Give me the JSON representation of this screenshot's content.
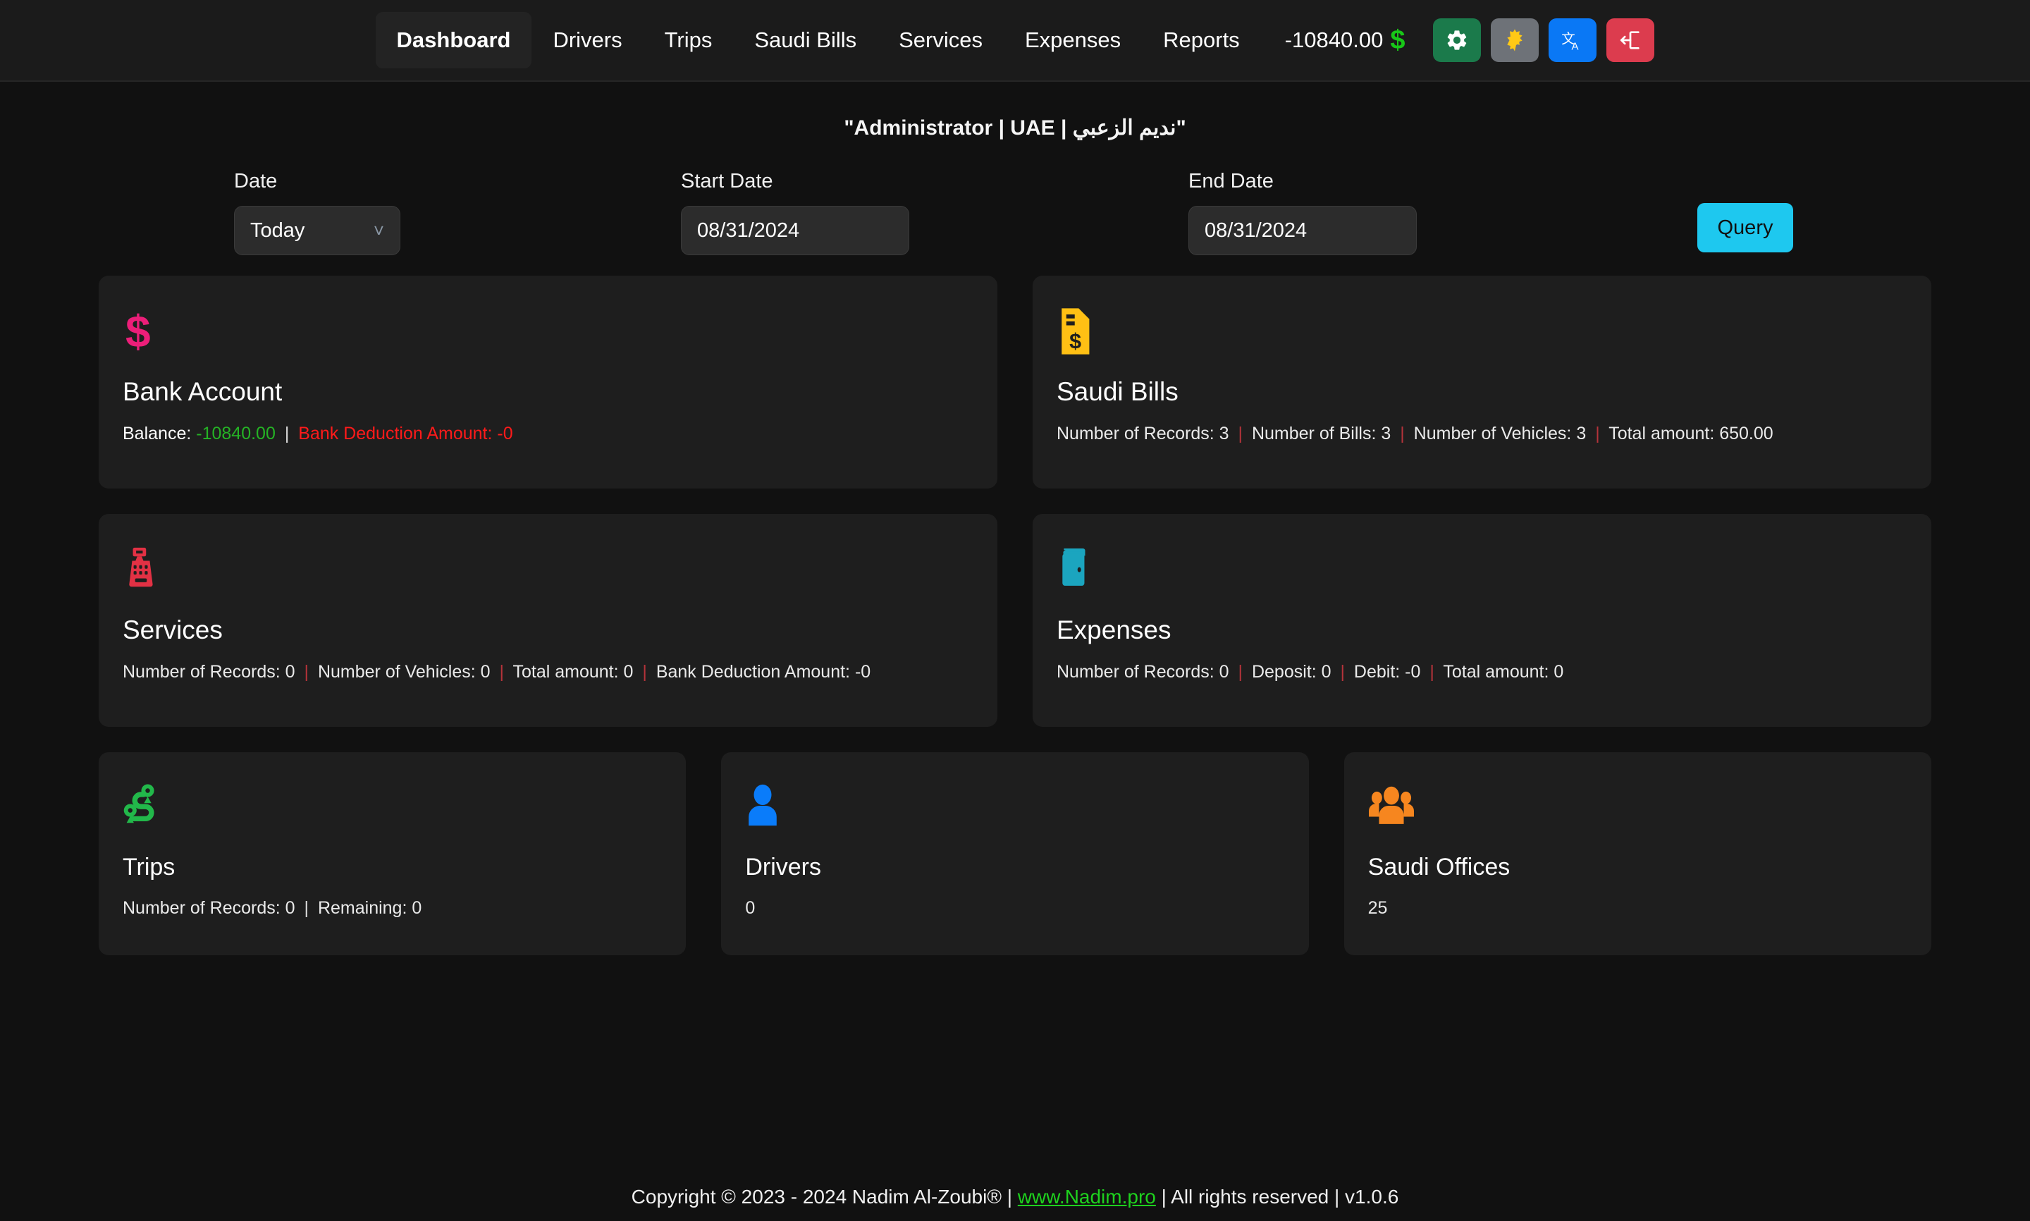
{
  "navbar": {
    "links": [
      {
        "label": "Dashboard",
        "active": true
      },
      {
        "label": "Drivers",
        "active": false
      },
      {
        "label": "Trips",
        "active": false
      },
      {
        "label": "Saudi Bills",
        "active": false
      },
      {
        "label": "Services",
        "active": false
      },
      {
        "label": "Expenses",
        "active": false
      },
      {
        "label": "Reports",
        "active": false
      }
    ],
    "balance": "-10840.00",
    "balance_symbol": "$",
    "balance_symbol_color": "#18c718",
    "buttons": [
      {
        "name": "settings-button",
        "icon": "gear-icon",
        "color": "#1b7a4b"
      },
      {
        "name": "theme-toggle-button",
        "icon": "sun-icon",
        "color": "#6e7278"
      },
      {
        "name": "language-button",
        "icon": "translate-icon",
        "color": "#0a78f5"
      },
      {
        "name": "logout-button",
        "icon": "logout-icon",
        "color": "#dc3c4e"
      }
    ]
  },
  "user_header": "\"نديم الزعبي | Administrator | UAE\"",
  "filters": {
    "date": {
      "label": "Date",
      "value": "Today",
      "options": [
        "Today"
      ]
    },
    "start_date": {
      "label": "Start Date",
      "value": "08/31/2024"
    },
    "end_date": {
      "label": "End Date",
      "value": "08/31/2024"
    },
    "query_button": "Query"
  },
  "cards": {
    "bank_account": {
      "title": "Bank Account",
      "icon": "dollar-sign-icon",
      "icon_color": "#ec1e79",
      "balance_label": "Balance:",
      "balance_value": "-10840.00",
      "deduction_text": "Bank Deduction Amount: -0"
    },
    "saudi_bills": {
      "title": "Saudi Bills",
      "icon": "invoice-icon",
      "icon_color": "#ffc014",
      "stat_records": "Number of Records: 3",
      "stat_bills": "Number of Bills: 3",
      "stat_vehicles": "Number of Vehicles: 3",
      "stat_total": "Total amount: 650.00"
    },
    "services": {
      "title": "Services",
      "icon": "cash-register-icon",
      "icon_color": "#e23144",
      "stat_records": "Number of Records: 0",
      "stat_vehicles": "Number of Vehicles: 0",
      "stat_total": "Total amount: 0",
      "stat_deduction": "Bank Deduction Amount: -0"
    },
    "expenses": {
      "title": "Expenses",
      "icon": "wallet-icon",
      "icon_color": "#1ba5bf",
      "stat_records": "Number of Records: 0",
      "stat_deposit": "Deposit: 0",
      "stat_debit": "Debit: -0",
      "stat_total": "Total amount: 0"
    },
    "trips": {
      "title": "Trips",
      "icon": "route-icon",
      "icon_color": "#22b84a",
      "stat_records": "Number of Records: 0",
      "stat_remaining": "Remaining: 0"
    },
    "drivers": {
      "title": "Drivers",
      "icon": "person-icon",
      "icon_color": "#0a7cfa",
      "count": "0"
    },
    "saudi_offices": {
      "title": "Saudi Offices",
      "icon": "people-group-icon",
      "icon_color": "#f6861f",
      "count": "25"
    }
  },
  "footer": {
    "copyright": "Copyright © 2023 - 2024 Nadim Al-Zoubi® | ",
    "link": "www.Nadim.pro",
    "tail": " | All rights reserved | v1.0.6"
  }
}
